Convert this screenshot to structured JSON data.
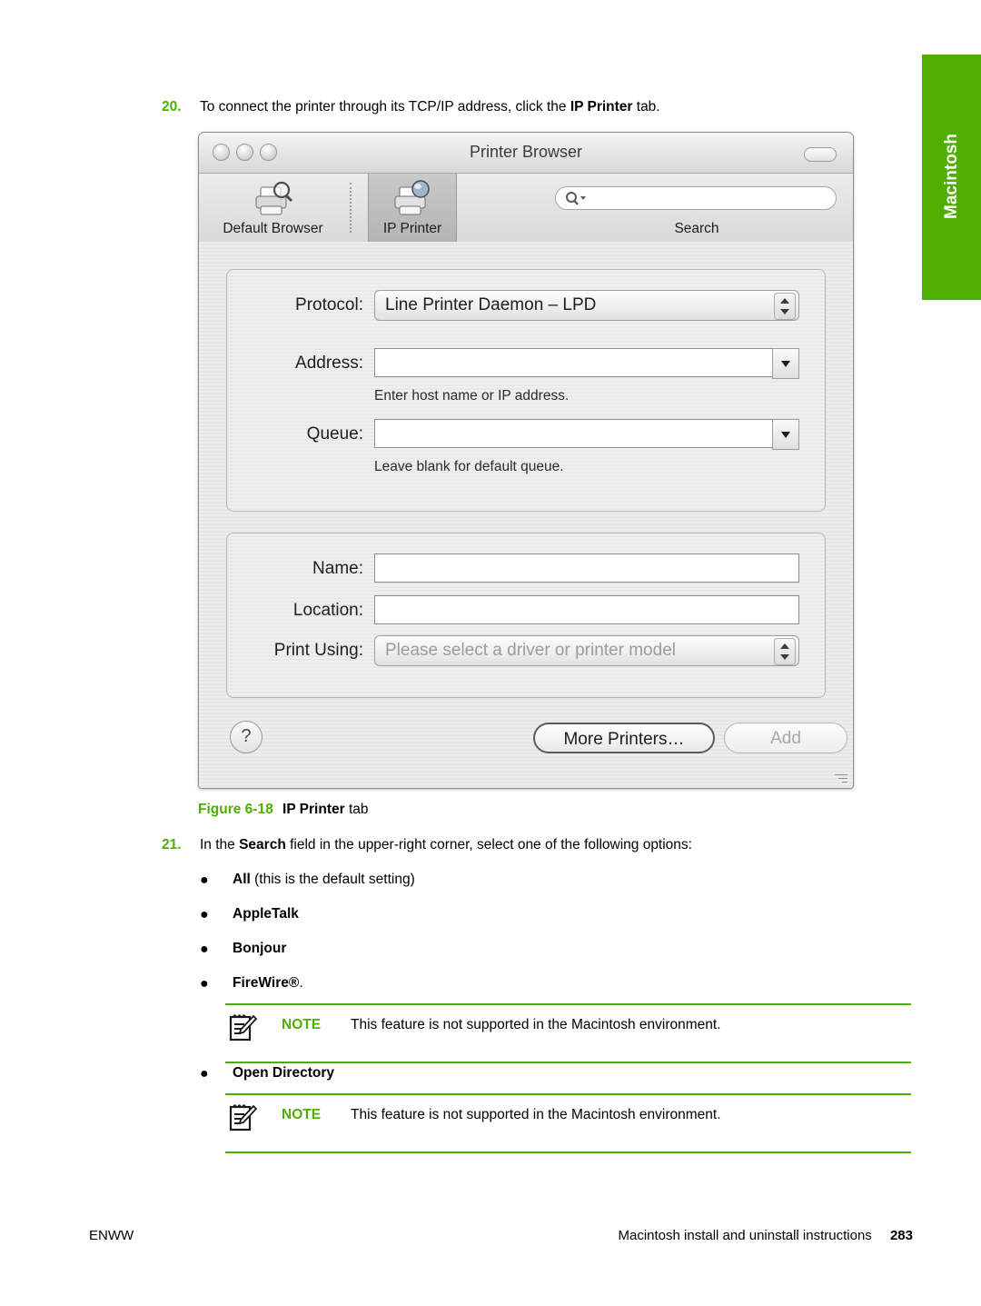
{
  "side_tab": {
    "label": "Macintosh",
    "color": "#4fae00"
  },
  "accent_color": "#4fae00",
  "steps": {
    "step20": {
      "number": "20.",
      "text_before": "To connect the printer through its TCP/IP address, click the ",
      "bold": "IP Printer",
      "text_after": " tab."
    },
    "step21": {
      "number": "21.",
      "text_before": "In the ",
      "bold": "Search",
      "text_after": " field in the upper-right corner, select one of the following options:"
    }
  },
  "dialog": {
    "window_title": "Printer Browser",
    "toolbar": {
      "default_browser_label": "Default Browser",
      "ip_printer_label": "IP Printer",
      "search_label": "Search",
      "search_value": "",
      "selected_tab": "IP Printer"
    },
    "group_connection": {
      "protocol_label": "Protocol:",
      "protocol_value": "Line Printer Daemon – LPD",
      "address_label": "Address:",
      "address_value": "",
      "address_help": "Enter host name or IP address.",
      "queue_label": "Queue:",
      "queue_value": "",
      "queue_help": "Leave blank for default queue."
    },
    "group_identity": {
      "name_label": "Name:",
      "name_value": "",
      "location_label": "Location:",
      "location_value": "",
      "print_using_label": "Print Using:",
      "print_using_value": "Please select a driver or printer model"
    },
    "buttons": {
      "help_label": "?",
      "more_printers_label": "More Printers…",
      "add_label": "Add"
    }
  },
  "figure_caption": {
    "prefix": "Figure 6-18",
    "bold": "IP Printer",
    "suffix": " tab"
  },
  "options": [
    {
      "bullet": "●",
      "bold": "All",
      "rest": " (this is the default setting)"
    },
    {
      "bullet": "●",
      "bold": "AppleTalk",
      "rest": ""
    },
    {
      "bullet": "●",
      "bold": "Bonjour",
      "rest": ""
    },
    {
      "bullet": "●",
      "bold": "FireWire®",
      "rest": "."
    },
    {
      "bullet": "●",
      "bold": "Open Directory",
      "rest": ""
    }
  ],
  "notes": [
    {
      "label": "NOTE",
      "text": "This feature is not supported in the Macintosh environment."
    },
    {
      "label": "NOTE",
      "text": "This feature is not supported in the Macintosh environment."
    }
  ],
  "footer": {
    "left": "ENWW",
    "right": "Macintosh install and uninstall instructions",
    "page": "283"
  }
}
